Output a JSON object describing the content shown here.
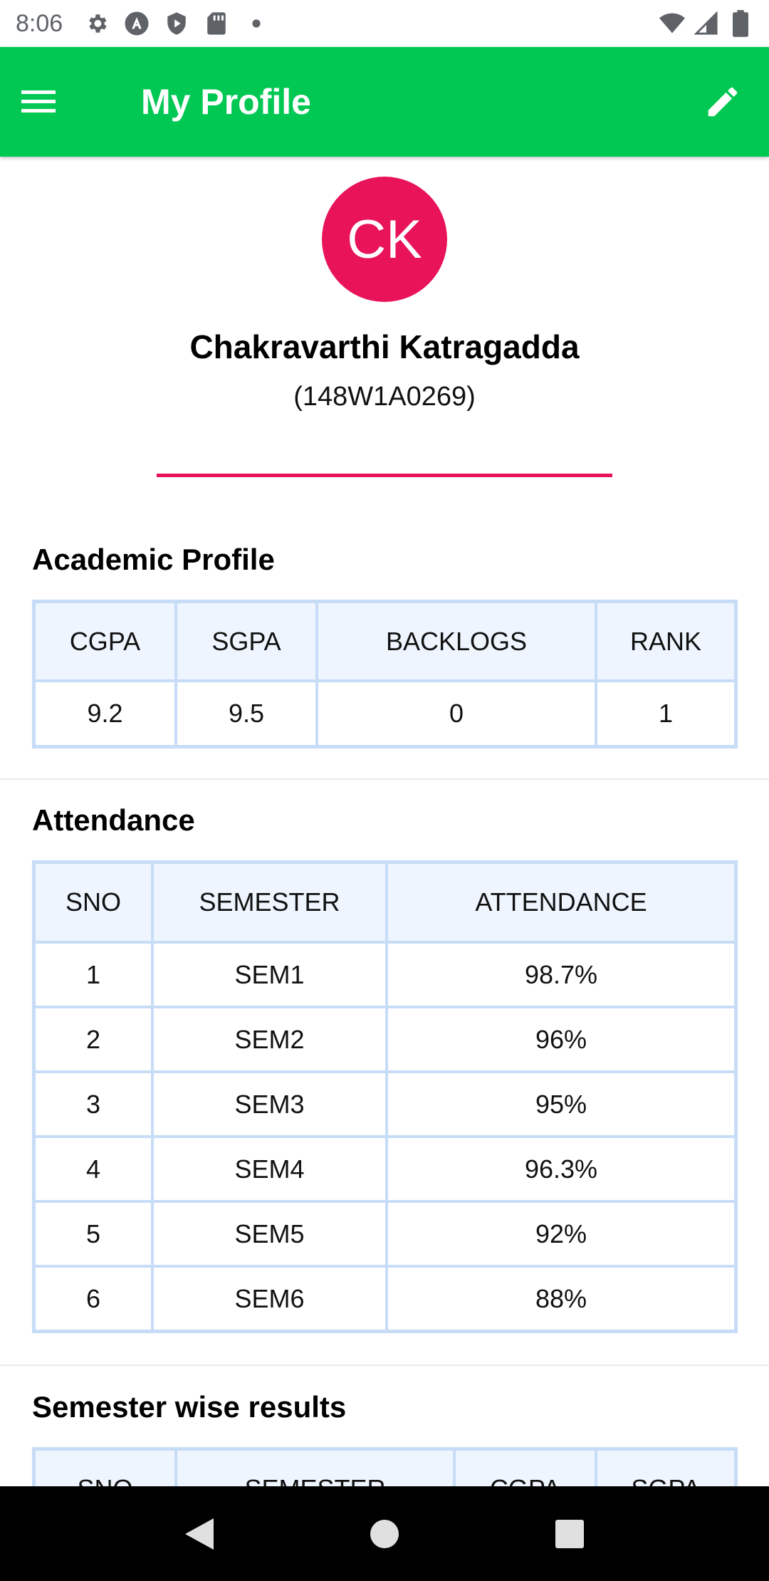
{
  "status_bar": {
    "time": "8:06",
    "left_icons": [
      "settings-icon",
      "a-circle-icon",
      "shield-play-icon",
      "sd-card-icon",
      "dot-icon"
    ],
    "right_icons": [
      "wifi-icon",
      "signal-icon",
      "battery-icon"
    ]
  },
  "app_bar": {
    "title": "My Profile",
    "color": "#00c853"
  },
  "profile": {
    "initials": "CK",
    "name": "Chakravarthi Katragadda",
    "id": "(148W1A0269)",
    "accent_color": "#e91359"
  },
  "academic": {
    "title": "Academic Profile",
    "headers": [
      "CGPA",
      "SGPA",
      "BACKLOGS",
      "RANK"
    ],
    "values": [
      "9.2",
      "9.5",
      "0",
      "1"
    ]
  },
  "attendance": {
    "title": "Attendance",
    "headers": [
      "SNO",
      "SEMESTER",
      "ATTENDANCE"
    ],
    "rows": [
      [
        "1",
        "SEM1",
        "98.7%"
      ],
      [
        "2",
        "SEM2",
        "96%"
      ],
      [
        "3",
        "SEM3",
        "95%"
      ],
      [
        "4",
        "SEM4",
        "96.3%"
      ],
      [
        "5",
        "SEM5",
        "92%"
      ],
      [
        "6",
        "SEM6",
        "88%"
      ]
    ]
  },
  "semester_results": {
    "title": "Semester wise results",
    "headers": [
      "SNO",
      "SEMESTER",
      "CGPA",
      "SGPA"
    ]
  },
  "nav_bar": {
    "buttons": [
      "back-icon",
      "home-icon",
      "recents-icon"
    ]
  }
}
